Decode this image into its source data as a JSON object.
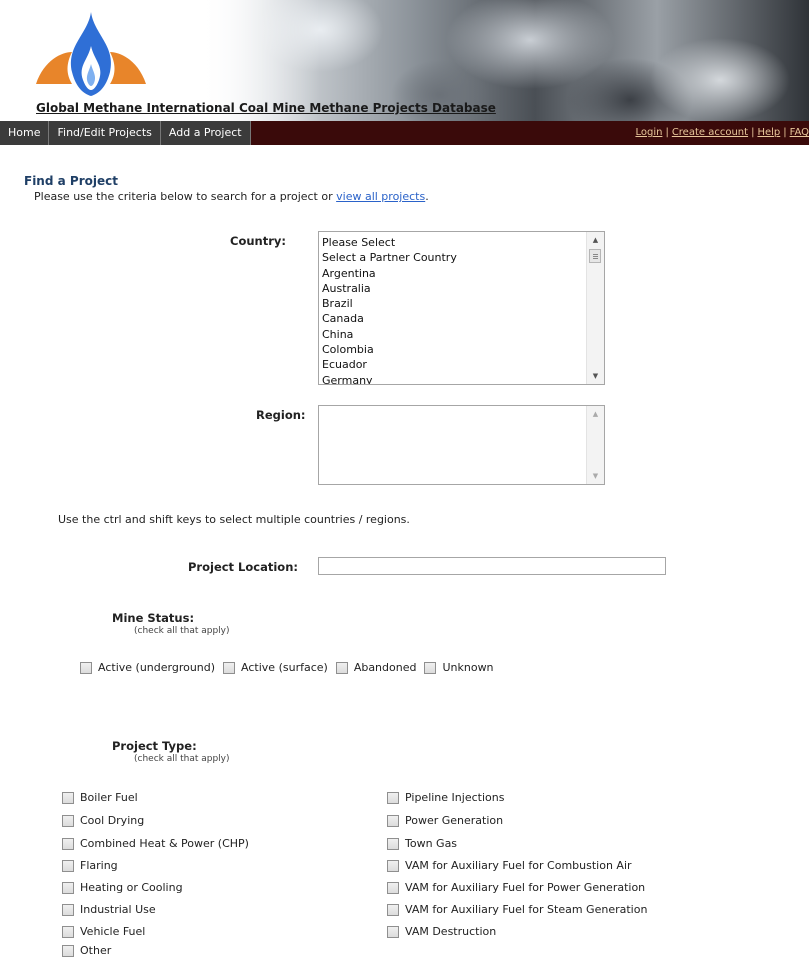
{
  "header": {
    "title": "Global Methane International Coal Mine Methane Projects Database"
  },
  "nav": {
    "left": [
      "Home",
      "Find/Edit Projects",
      "Add a Project"
    ],
    "right": [
      "Login",
      "Create account",
      "Help",
      "FAQ"
    ]
  },
  "page": {
    "heading": "Find a Project",
    "intro_text": "Please use the criteria below to search for a project or ",
    "intro_link": "view all projects",
    "intro_end": "."
  },
  "country": {
    "label": "Country:",
    "options": [
      "Please Select",
      "Select a Partner Country",
      "Argentina",
      "Australia",
      "Brazil",
      "Canada",
      "China",
      "Colombia",
      "Ecuador",
      "Germany"
    ]
  },
  "region": {
    "label": "Region:",
    "options": []
  },
  "hint": "Use the ctrl and shift keys to select multiple countries / regions.",
  "project_location": {
    "label": "Project Location:",
    "value": ""
  },
  "mine_status": {
    "title": "Mine Status:",
    "subtitle": "(check all that apply)",
    "options": [
      "Active (underground)",
      "Active (surface)",
      "Abandoned",
      "Unknown"
    ]
  },
  "project_type": {
    "title": "Project Type:",
    "subtitle": "(check all that apply)",
    "left": [
      "Boiler Fuel",
      "Cool Drying",
      "Combined Heat & Power (CHP)",
      "Flaring",
      "Heating or Cooling",
      "Industrial Use",
      "Vehicle Fuel",
      "Other"
    ],
    "right": [
      "Pipeline Injections",
      "Power Generation",
      "Town Gas",
      "VAM for Auxiliary Fuel for Combustion Air",
      "VAM for Auxiliary Fuel for Power Generation",
      "VAM for Auxiliary Fuel for Steam Generation",
      "VAM Destruction"
    ]
  },
  "colors": {
    "nav_bg": "#3a0a0a",
    "nav_link": "#e8c79b",
    "heading": "#1f3f66",
    "link": "#2a62c9",
    "flame_blue": "#2f6fd6",
    "flame_orange": "#e8852a"
  }
}
